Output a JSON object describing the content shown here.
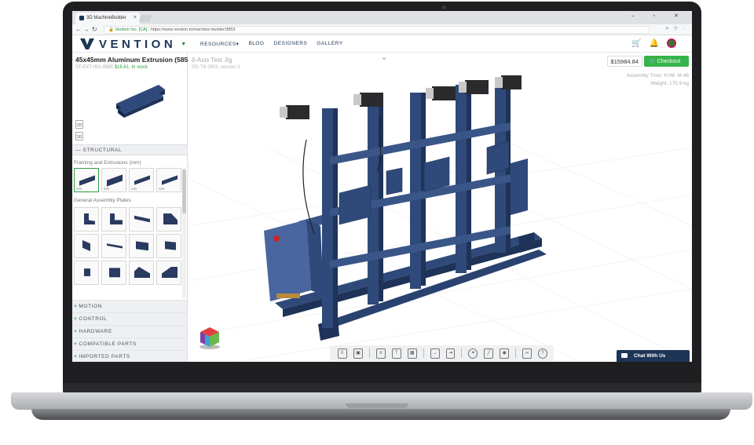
{
  "browser": {
    "tab_title": "3D MachineBuilder",
    "url_secure": "Vention Inc. [CA]",
    "url": "https://www.vention.io/machine-builder/3853",
    "window_controls": "–  ▫  ✕"
  },
  "header": {
    "logo_text": "VENTION",
    "nav": [
      "RESOURCES▾",
      "BLOG",
      "DESIGNERS",
      "GALLERY"
    ]
  },
  "part": {
    "title": "45x45mm Aluminum Extrusion (585...",
    "sku": "ST-EXT-001-0585",
    "price": "$16.61,",
    "stock": "In stock",
    "view_2d": "2D",
    "view_3d": "3D"
  },
  "library": {
    "section": "STRUCTURAL",
    "subsection_1": "Framing and Extrusions (mm)",
    "extrusion_lengths": [
      "585",
      "585",
      "585",
      "585"
    ],
    "subsection_2": "General Assembly Plates",
    "categories": [
      "MOTION",
      "CONTROL",
      "HARDWARE",
      "COMPATIBLE PARTS",
      "IMPORTED PARTS"
    ]
  },
  "design": {
    "name": "6-Axis Test Jig",
    "id": "RD-TB-3853, version 3",
    "price": "$15984.84",
    "checkout_label": "Checkout",
    "assembly_time": "Assembly Time: H 08: M 48",
    "weight": "Weight: 175.9 kg"
  },
  "chat": {
    "label": "Chat With Us"
  },
  "colors": {
    "brand": "#1d3557",
    "accent_green": "#36b34a",
    "machine_blue": "#2f4a7a"
  },
  "icons": [
    "save-icon",
    "open-icon",
    "bom-icon",
    "tree-icon",
    "calc-icon",
    "import-icon",
    "export-icon",
    "explode-icon",
    "measure-icon",
    "camera-icon",
    "link-icon",
    "help-icon"
  ]
}
